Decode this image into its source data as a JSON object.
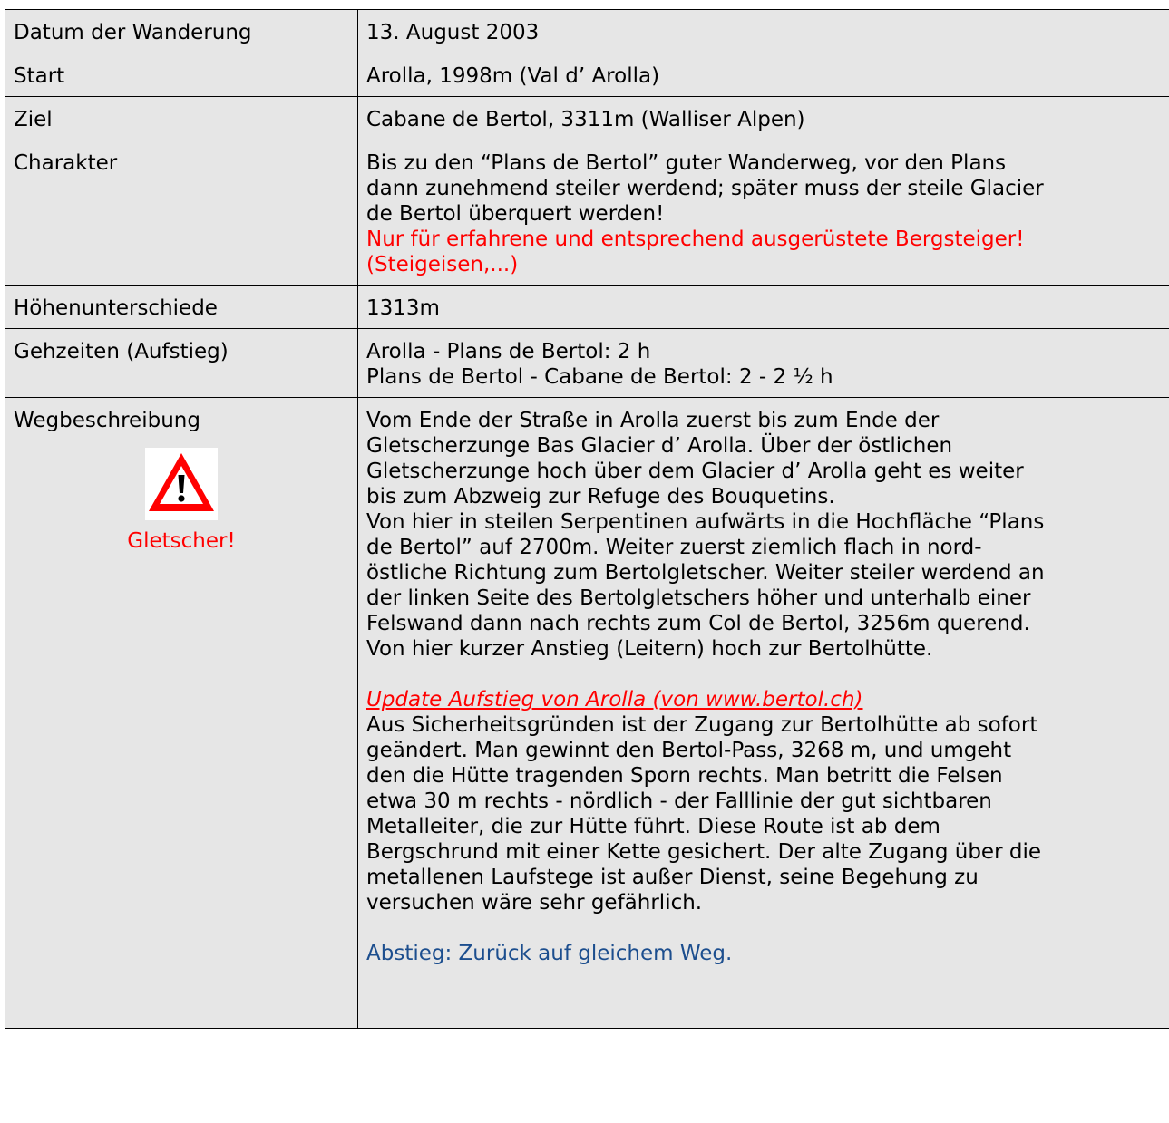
{
  "rows": [
    {
      "label": "Datum der Wanderung",
      "value": "13. August 2003"
    },
    {
      "label": "Start",
      "value": "Arolla, 1998m (Val d’ Arolla)"
    },
    {
      "label": "Ziel",
      "value": "Cabane de Bertol, 3311m (Walliser Alpen)"
    },
    {
      "label": "Charakter",
      "lines": [
        "Bis zu den “Plans de Bertol” guter Wanderweg, vor den Plans",
        "dann zunehmend steiler werdend; später muss der steile Glacier",
        "de Bertol überquert werden!"
      ],
      "warning_lines": [
        "Nur für erfahrene und entsprechend ausgerüstete Bergsteiger!",
        "(Steigeisen,...)"
      ]
    },
    {
      "label": "Höhenunterschiede",
      "value": "1313m"
    },
    {
      "label": "Gehzeiten (Aufstieg)",
      "lines": [
        "Arolla - Plans de Bertol: 2 h",
        "Plans de Bertol - Cabane de Bertol: 2 - 2 ½ h"
      ]
    },
    {
      "label": "Wegbeschreibung",
      "warning_icon": "warning-triangle-icon",
      "warning_caption": "Gletscher!",
      "paragraph1": [
        "Vom Ende der Straße in Arolla zuerst bis zum Ende der",
        "Gletscherzunge Bas Glacier d’ Arolla. Über der östlichen",
        "Gletscherzunge hoch über dem Glacier d’ Arolla geht es weiter",
        "bis zum Abzweig zur Refuge des Bouquetins.",
        "Von hier in steilen Serpentinen aufwärts in die Hochfläche “Plans",
        "de Bertol” auf 2700m. Weiter zuerst ziemlich flach in nord-",
        "östliche Richtung zum Bertolgletscher. Weiter steiler werdend an",
        "der linken Seite des Bertolgletschers höher und unterhalb einer",
        "Felswand dann nach rechts zum Col de Bertol, 3256m querend.",
        "Von hier kurzer Anstieg (Leitern) hoch zur Bertolhütte."
      ],
      "update_link": "Update Aufstieg von Arolla (von www.bertol.ch)",
      "paragraph2": [
        "Aus Sicherheitsgründen ist der Zugang zur  Bertolhütte ab sofort",
        "geändert. Man gewinnt den Bertol-Pass, 3268 m, und umgeht",
        "den die Hütte tragenden Sporn rechts. Man betritt die Felsen",
        "etwa 30 m rechts - nördlich - der Falllinie der gut sichtbaren",
        "Metalleiter, die zur Hütte führt. Diese Route ist ab dem",
        "Bergschrund mit einer Kette gesichert. Der alte Zugang über die",
        "metallenen Laufstege ist außer Dienst, seine Begehung zu",
        "versuchen wäre sehr gefährlich."
      ],
      "descent": "Abstieg: Zurück auf gleichem Weg."
    }
  ],
  "colors": {
    "cell_background": "#e6e6e6",
    "warning_red": "#ff0000",
    "descent_blue": "#1c4e8e"
  }
}
